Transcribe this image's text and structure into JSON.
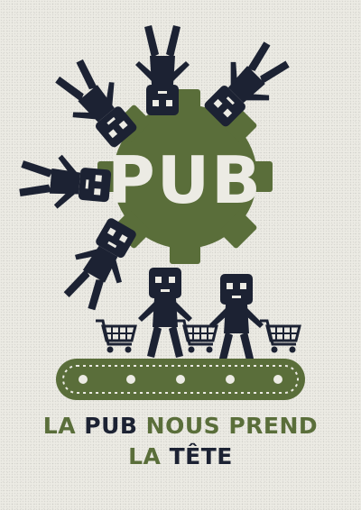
{
  "gear_label": "PUB",
  "slogan": {
    "line1": {
      "part1": "LA ",
      "part2": "PUB",
      "part3": " NOUS PREND"
    },
    "line2": {
      "part1": "LA ",
      "part2": "TÊTE"
    }
  },
  "colors": {
    "background": "#ecebe4",
    "green": "#5a6e3a",
    "navy": "#1c2233",
    "gear_text": "#ecebe4"
  },
  "icons": [
    "gear-icon",
    "person-icon",
    "shopping-cart-icon",
    "conveyor-belt-icon"
  ]
}
